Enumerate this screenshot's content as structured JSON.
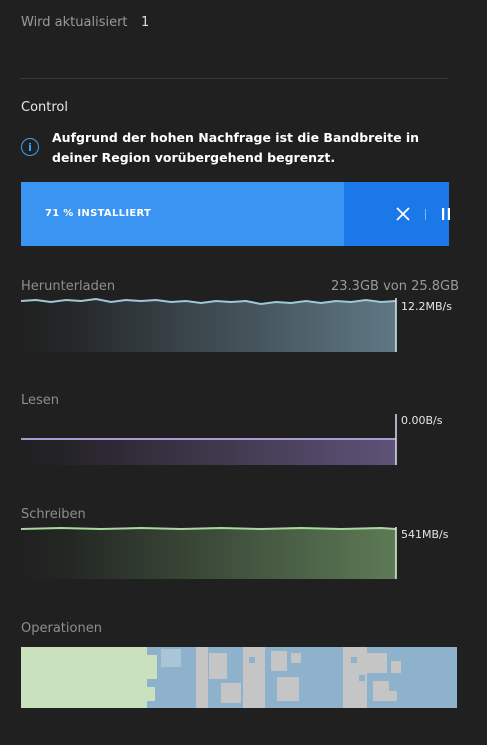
{
  "updating": {
    "label": "Wird aktualisiert",
    "count": "1"
  },
  "section_title": "Control",
  "notice": "Aufgrund der hohen Nachfrage ist die Bandbreite in deiner Region vorübergehend begrenzt.",
  "install": {
    "progress_label": "71 % INSTALLIERT",
    "progress": 0.71
  },
  "download": {
    "label": "Herunterladen",
    "size": "23.3GB von 25.8GB",
    "rate": "12.2MB/s",
    "color": "#9ec8d8"
  },
  "read": {
    "label": "Lesen",
    "rate": "0.00B/s",
    "color": "#a99ad6"
  },
  "write": {
    "label": "Schreiben",
    "rate": "541MB/s",
    "color": "#a8d8a0"
  },
  "operations": {
    "label": "Operationen",
    "colors": [
      "#c9e2bd",
      "#8fb2cc",
      "#c5c5c5"
    ]
  }
}
